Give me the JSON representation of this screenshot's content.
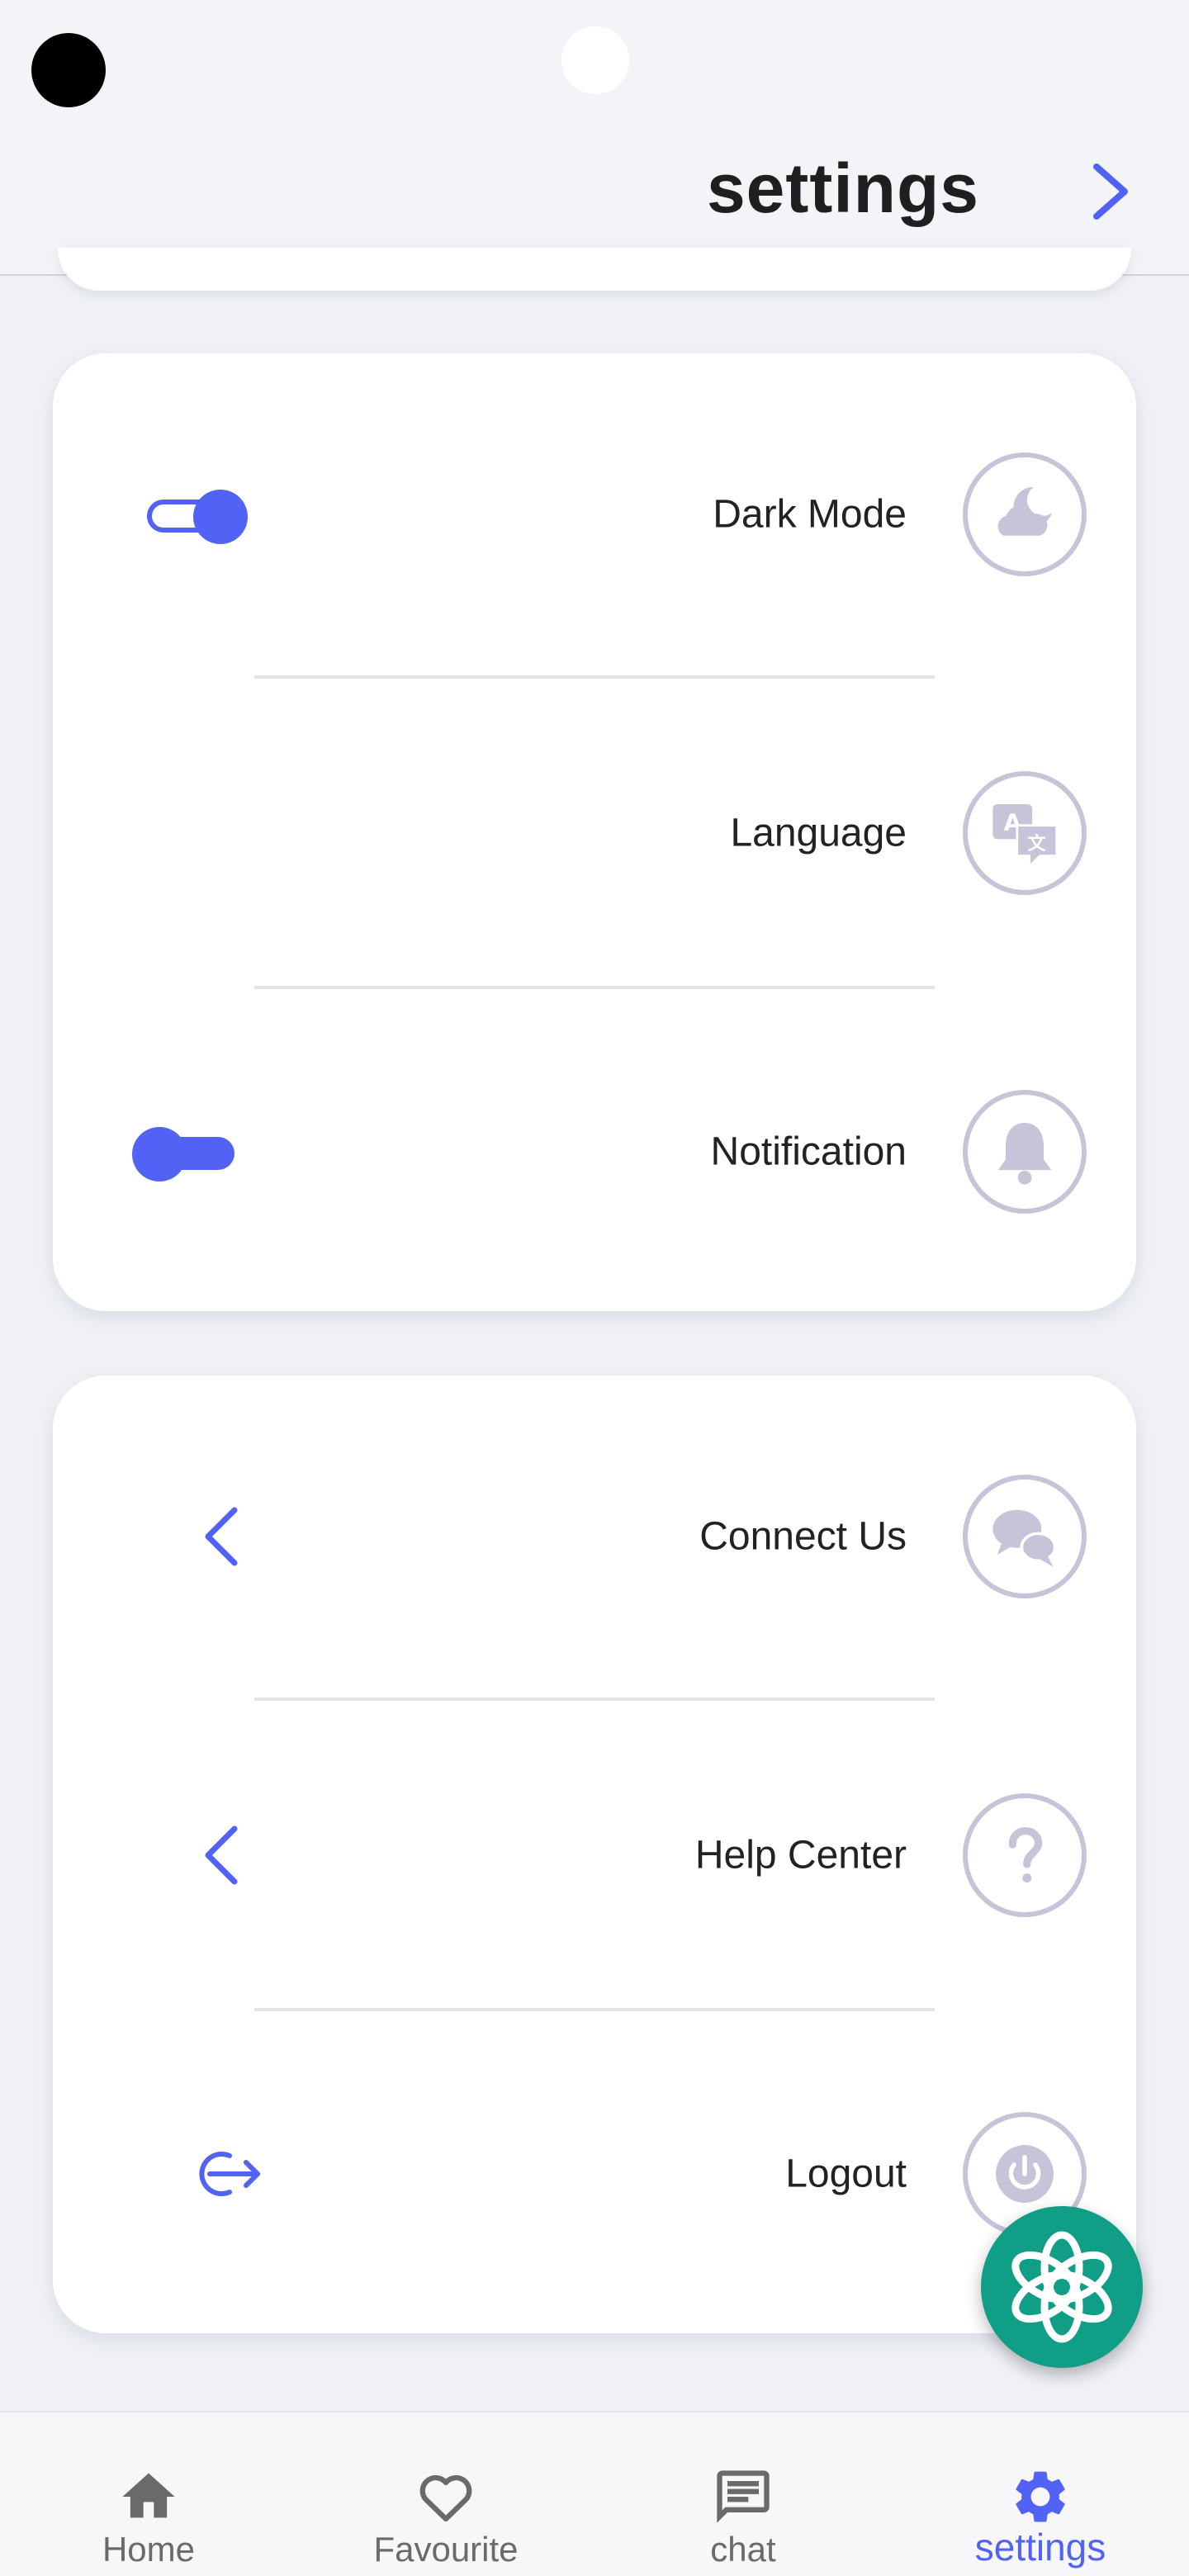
{
  "header": {
    "title": "settings",
    "forward_icon": "chevron-right-icon"
  },
  "colors": {
    "accent": "#5162f5",
    "icon_muted": "#c6c4d8",
    "background": "#eff1f6",
    "card": "#ffffff",
    "fab": "#109e86"
  },
  "preferences": {
    "dark_mode": {
      "label": "Dark Mode",
      "icon": "moon-cloud-icon",
      "toggle_on": true
    },
    "language": {
      "label": "Language",
      "icon": "translate-icon"
    },
    "notification": {
      "label": "Notification",
      "icon": "bell-icon",
      "toggle_on": false
    }
  },
  "support": {
    "connect_us": {
      "label": "Connect Us",
      "icon": "chat-bubbles-icon"
    },
    "help_center": {
      "label": "Help Center",
      "icon": "question-icon"
    },
    "logout": {
      "label": "Logout",
      "icon": "power-icon"
    }
  },
  "fab": {
    "icon": "chatgpt-icon"
  },
  "bottom_nav": [
    {
      "label": "Home",
      "icon": "home-icon",
      "active": false
    },
    {
      "label": "Favourite",
      "icon": "heart-icon",
      "active": false
    },
    {
      "label": "chat",
      "icon": "chat-icon",
      "active": false
    },
    {
      "label": "settings",
      "icon": "gear-icon",
      "active": true
    }
  ]
}
